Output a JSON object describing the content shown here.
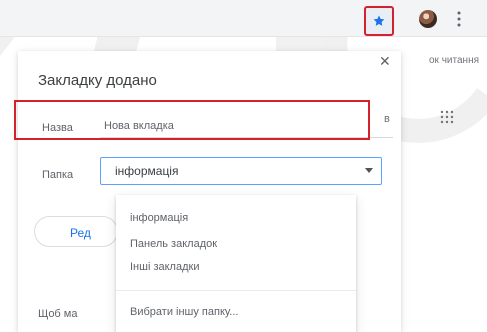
{
  "toolbar": {
    "read_label": "ок читання"
  },
  "dialog": {
    "title": "Закладку додано",
    "name_label": "Назва",
    "name_value": "Нова вкладка",
    "folder_label": "Папка",
    "folder_value": "інформація",
    "left_action_label": "Ред",
    "bottom_prompt": "Щоб ма",
    "side_fragment": "в"
  },
  "dropdown": {
    "items": [
      "інформація",
      "Панель закладок",
      "Інші закладки"
    ],
    "choose_other": "Вибрати іншу папку..."
  },
  "icons": {
    "bookmark": "star-icon",
    "close": "close-icon",
    "menu": "more-vert-icon",
    "apps": "apps-grid-icon",
    "folder_arrow": "chevron-down-icon"
  },
  "colors": {
    "highlight": "#d3212d",
    "accent": "#1a73e8",
    "focus": "#5aa2ff",
    "text": "#3c4043",
    "muted": "#5f6368"
  }
}
